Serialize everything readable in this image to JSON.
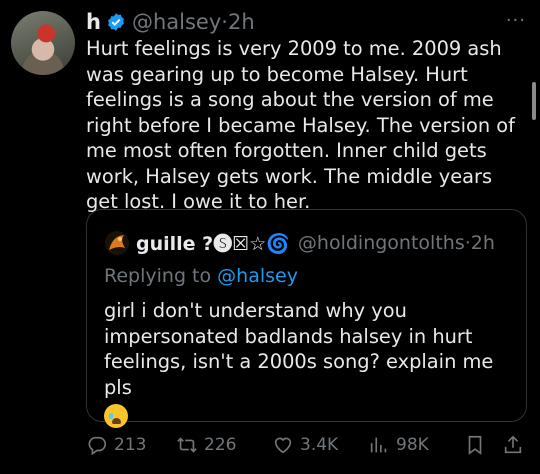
{
  "tweet": {
    "display_name": "h",
    "handle": "@halsey",
    "dot": "·",
    "time": "2h",
    "more": "···",
    "text": "Hurt feelings is very 2009 to me. 2009 ash was gearing up to become Halsey. Hurt feelings is a song about the version of me right before I became Halsey. The version of me most often forgotten. Inner child gets work, Halsey gets work. The middle years get lost. I owe it to her."
  },
  "quote": {
    "display_name": "guille ?🅢☒☆🌀",
    "handle": "@holdingontolths",
    "dot": "·",
    "time": "2h",
    "replying_prefix": "Replying to",
    "replying_handle": "@halsey",
    "text": "girl i don't understand why you impersonated badlands halsey in hurt feelings, isn't a 2000s song? explain me pls"
  },
  "actions": {
    "replies": "213",
    "reposts": "226",
    "likes": "3.4K",
    "views": "98K"
  },
  "colors": {
    "background": "#000000",
    "text": "#e7e9ea",
    "muted": "#71767b",
    "link": "#1d9bf0",
    "border": "#2f3336"
  }
}
